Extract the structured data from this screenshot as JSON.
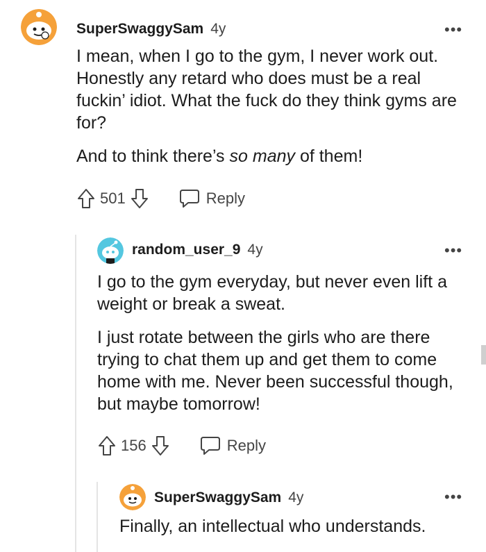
{
  "comments": [
    {
      "username": "SuperSwaggySam",
      "age": "4y",
      "paragraphs": [
        "I mean, when I go to the gym, I never work out. Honestly any retard who does must be a real fuckin’ idiot. What the fuck do they think gyms are for?",
        "And to think there’s so many of them!"
      ],
      "emphasis": "so many",
      "votes": "501",
      "reply_label": "Reply"
    },
    {
      "username": "random_user_9",
      "age": "4y",
      "paragraphs": [
        "I go to the gym everyday, but never even lift a weight or break a sweat.",
        "I just rotate between the girls who are there trying to chat them up and get them to come home with me. Never been successful though, but maybe tomorrow!"
      ],
      "votes": "156",
      "reply_label": "Reply"
    },
    {
      "username": "SuperSwaggySam",
      "age": "4y",
      "paragraphs": [
        "Finally, an intellectual who understands."
      ]
    }
  ],
  "more_label": "•••",
  "colors": {
    "snoo_orange": "#f5a13a",
    "snoo_blue": "#54c7e0",
    "thread_line": "#e4e4e4"
  },
  "icons": [
    "snoo-avatar-icon",
    "upvote-icon",
    "downvote-icon",
    "reply-bubble-icon",
    "more-options-icon"
  ]
}
